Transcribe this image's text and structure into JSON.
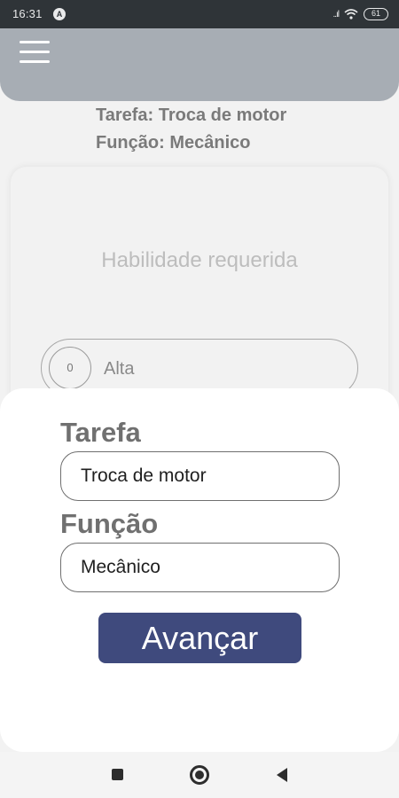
{
  "status_bar": {
    "time": "16:31",
    "notification_badge": "A",
    "signal_glyph": "..ıl",
    "battery_level": "61"
  },
  "header": {
    "task_line": "Tarefa: Troca de motor",
    "role_line": "Função: Mecânico"
  },
  "skills_card": {
    "title": "Habilidade requerida",
    "items": [
      {
        "count": "0",
        "label": "Alta"
      }
    ]
  },
  "form": {
    "task_label": "Tarefa",
    "task_value": "Troca de motor",
    "role_label": "Função",
    "role_value": "Mecânico",
    "advance_label": "Avançar"
  },
  "icons": {
    "menu": "hamburger-menu-icon",
    "recents": "recents-square-icon",
    "home": "home-circle-icon",
    "back": "back-triangle-icon"
  },
  "colors": {
    "topbar": "#a7adb4",
    "button": "#3f4a7d",
    "statusbar": "#2f3438"
  }
}
